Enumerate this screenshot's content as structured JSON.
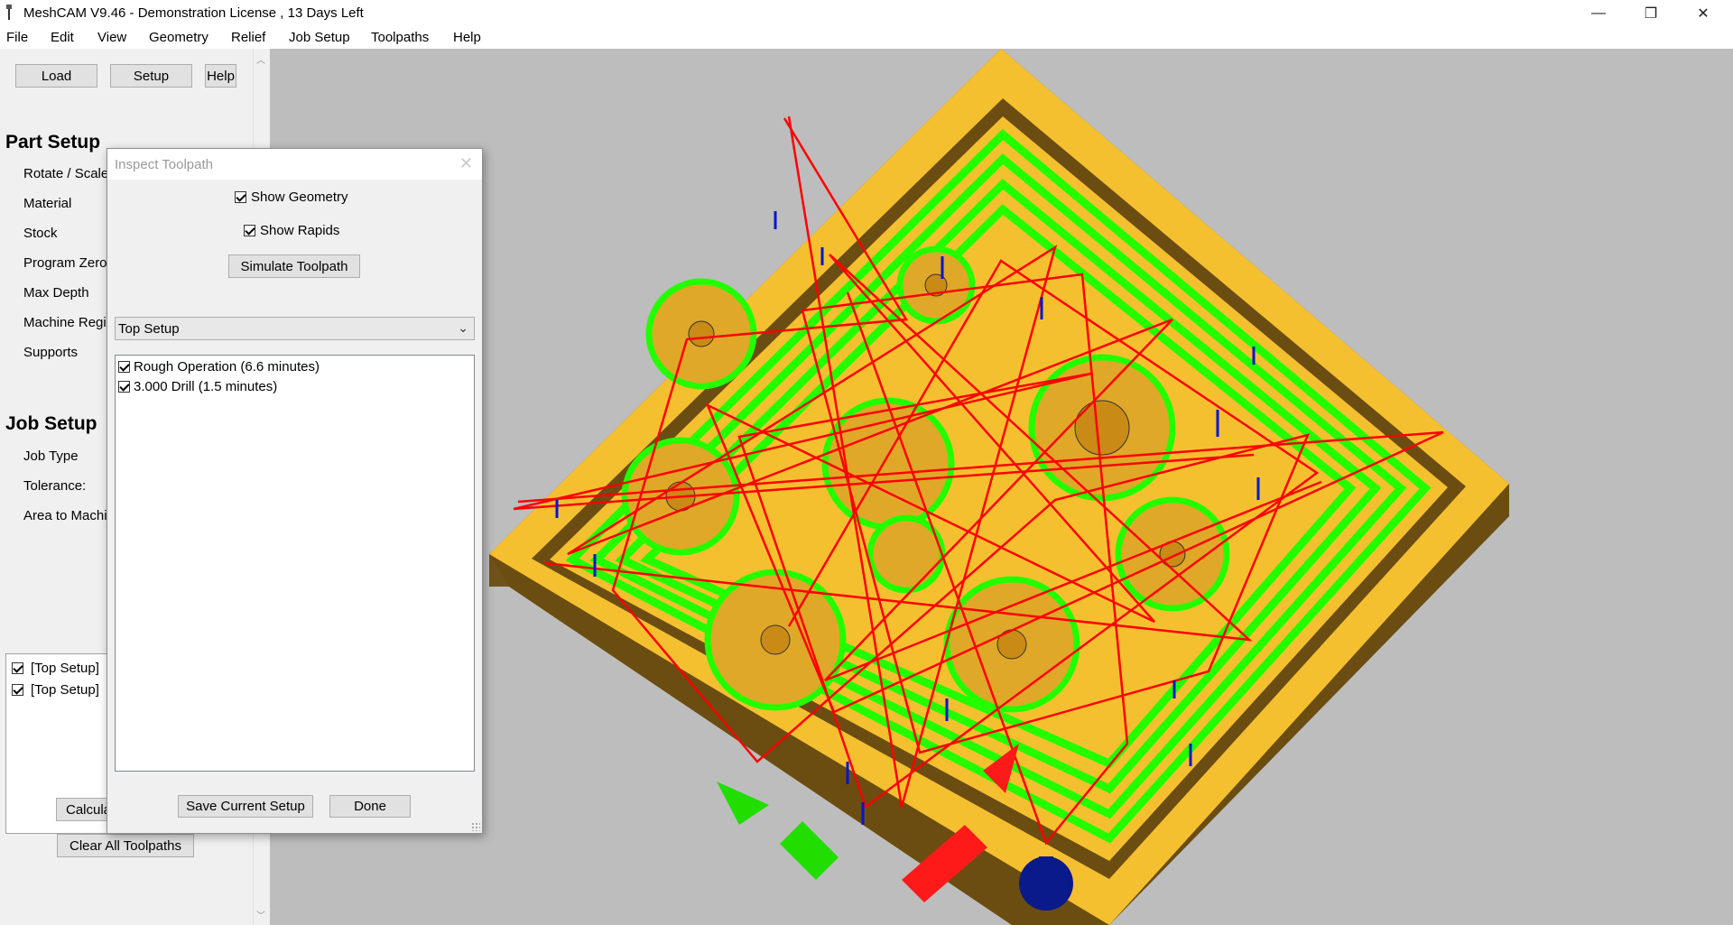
{
  "window": {
    "title": "MeshCAM V9.46 - Demonstration License  , 13 Days Left",
    "minimize_glyph": "—",
    "maximize_glyph": "❐",
    "close_glyph": "✕"
  },
  "menu": [
    "File",
    "Edit",
    "View",
    "Geometry",
    "Relief",
    "Job Setup",
    "Toolpaths",
    "Help"
  ],
  "toolbar": {
    "load_label": "Load",
    "setup_label": "Setup",
    "help_label": "Help"
  },
  "part_setup": {
    "title": "Part Setup",
    "items": [
      "Rotate / Scale",
      "Material",
      "Stock",
      "Program Zero",
      "Max Depth",
      "Machine Regi",
      "Supports"
    ]
  },
  "job_setup": {
    "title": "Job Setup",
    "items": [
      "Job Type",
      "Tolerance:",
      "Area to Machi"
    ]
  },
  "setups_list": [
    {
      "label": "[Top Setup]",
      "checked": true
    },
    {
      "label": "[Top Setup]",
      "checked": true
    }
  ],
  "bottom_buttons": {
    "calculate_label": "Calcula",
    "clear_label": "Clear All Toolpaths"
  },
  "dialog": {
    "title": "Inspect Toolpath",
    "close_glyph": "✕",
    "show_geometry_label": "Show Geometry",
    "show_geometry_checked": true,
    "show_rapids_label": "Show Rapids",
    "show_rapids_checked": true,
    "simulate_label": "Simulate Toolpath",
    "setup_select_value": "Top Setup",
    "operations": [
      {
        "label": "Rough Operation (6.6 minutes)",
        "checked": true
      },
      {
        "label": "3.000 Drill (1.5 minutes)",
        "checked": true
      }
    ],
    "save_label": "Save Current Setup",
    "done_label": "Done"
  },
  "colors": {
    "stock": "#f5c030",
    "stock_wall": "#6b4d12",
    "toolpath": "#22ff00",
    "rapids": "#ff0000",
    "plunge": "#0018cc",
    "viewport_bg": "#bdbdbd"
  },
  "icons": {
    "app": "meshcam-app-icon",
    "dropdown": "chevron-down-icon",
    "scroll_up": "scroll-up-icon",
    "scroll_down": "scroll-down-icon"
  }
}
